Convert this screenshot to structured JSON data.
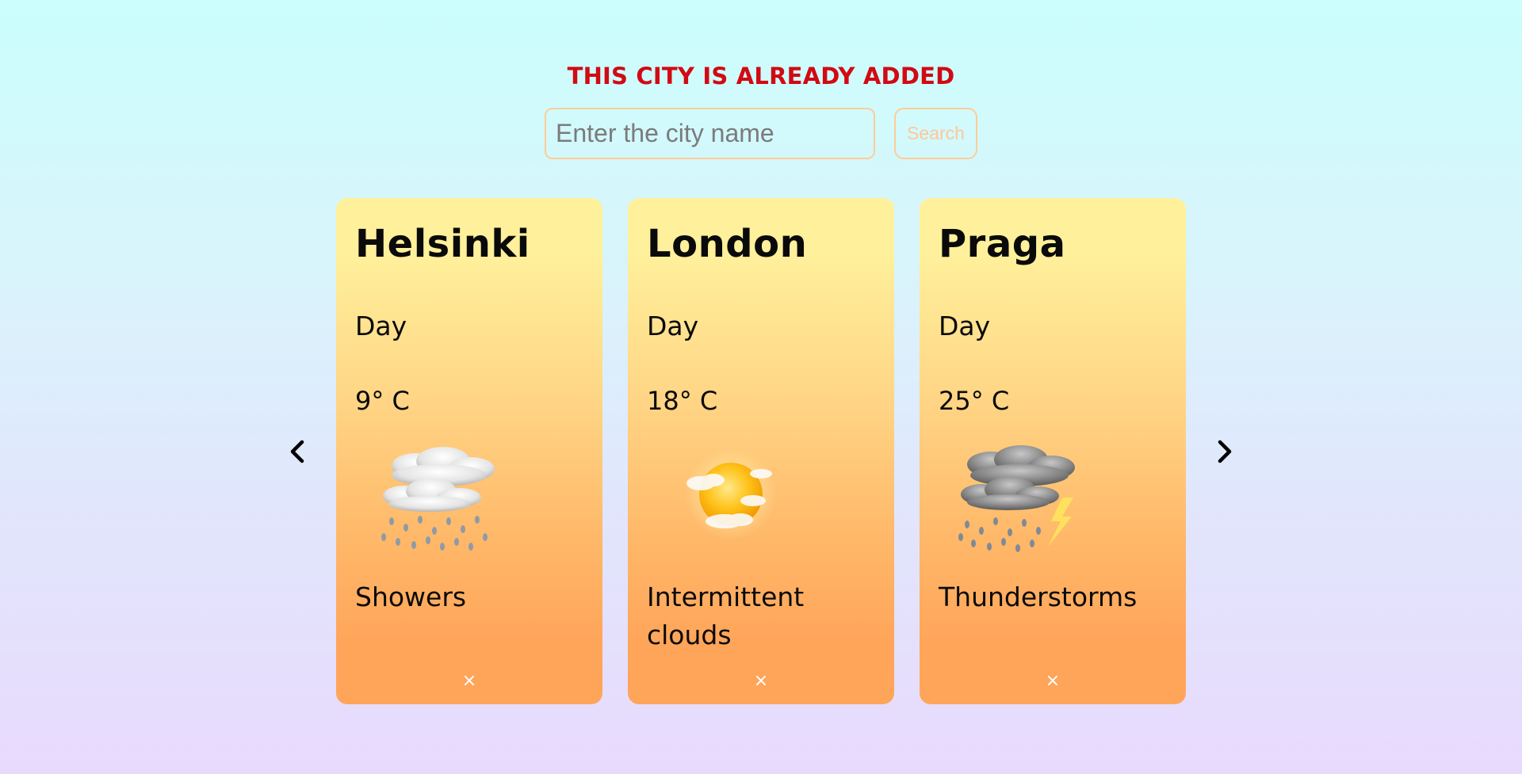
{
  "error_message": "THIS CITY IS ALREADY ADDED",
  "search": {
    "placeholder": "Enter the city name",
    "value": "",
    "button_label": "Search"
  },
  "navigation": {
    "prev_icon": "chevron-left-icon",
    "next_icon": "chevron-right-icon"
  },
  "cards": [
    {
      "city": "Helsinki",
      "period": "Day",
      "temperature": "9° C",
      "icon": "showers-icon",
      "condition": "Showers",
      "remove_label": "×"
    },
    {
      "city": "London",
      "period": "Day",
      "temperature": "18° C",
      "icon": "partly-sunny-icon",
      "condition": "Intermittent clouds",
      "remove_label": "×"
    },
    {
      "city": "Praga",
      "period": "Day",
      "temperature": "25° C",
      "icon": "thunderstorm-icon",
      "condition": "Thunderstorms",
      "remove_label": "×"
    }
  ],
  "colors": {
    "error": "#d10a14",
    "accent_border": "#ffcc97",
    "card_top": "#fff09b",
    "card_bottom": "#ffa55a"
  }
}
